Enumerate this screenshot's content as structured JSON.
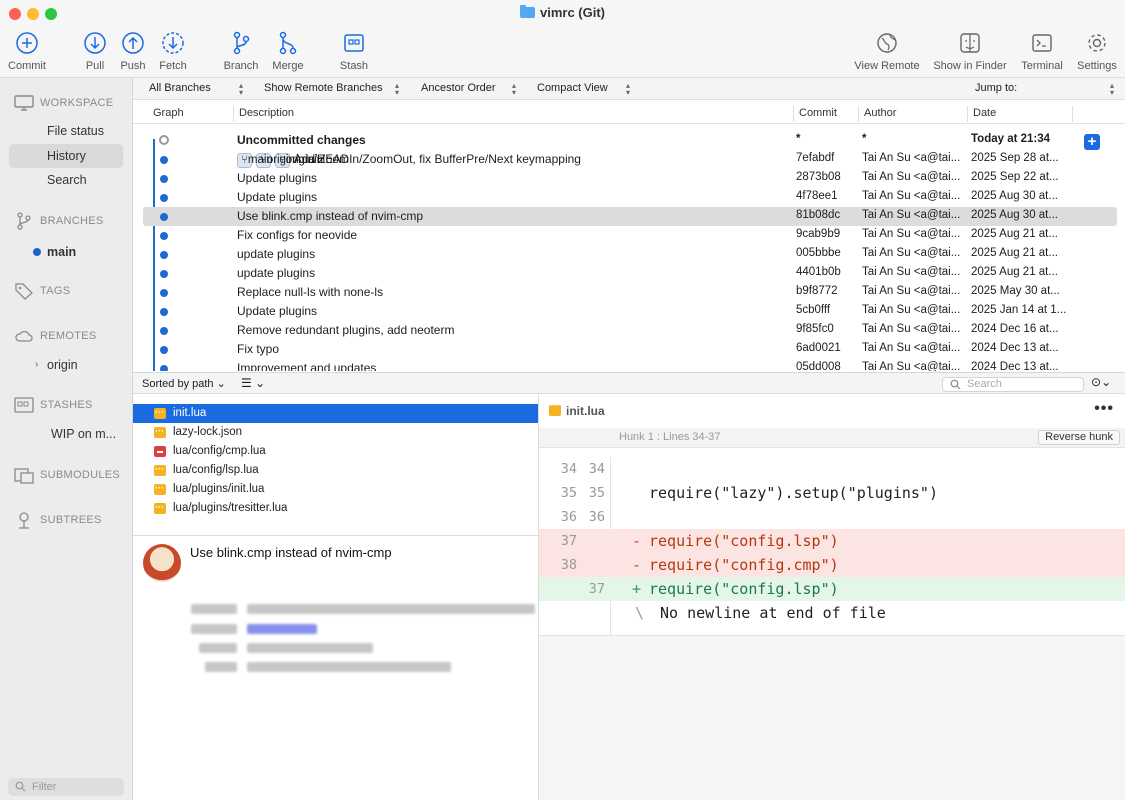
{
  "window": {
    "title": "vimrc (Git)"
  },
  "toolbar": {
    "commit": "Commit",
    "pull": "Pull",
    "push": "Push",
    "fetch": "Fetch",
    "branch": "Branch",
    "merge": "Merge",
    "stash": "Stash",
    "view_remote": "View Remote",
    "show_in_finder": "Show in Finder",
    "terminal": "Terminal",
    "settings": "Settings"
  },
  "sidebar": {
    "workspace": "WORKSPACE",
    "file_status": "File status",
    "history": "History",
    "search": "Search",
    "branches": "BRANCHES",
    "main_branch": "main",
    "tags": "TAGS",
    "remotes": "REMOTES",
    "origin": "origin",
    "stashes": "STASHES",
    "stash_item": "WIP on m...",
    "submodules": "SUBMODULES",
    "subtrees": "SUBTREES",
    "filter_placeholder": "Filter"
  },
  "filterbar": {
    "branches": "All Branches",
    "remote": "Show Remote Branches",
    "order": "Ancestor Order",
    "view": "Compact View",
    "jump": "Jump to:"
  },
  "columns": {
    "graph": "Graph",
    "description": "Description",
    "commit": "Commit",
    "author": "Author",
    "date": "Date"
  },
  "commits": [
    {
      "desc": "Uncommitted changes",
      "hash": "*",
      "author": "*",
      "date": "Today at 21:34"
    },
    {
      "tags": [
        "main",
        "origin/main",
        "origin/HEAD"
      ],
      "desc": "Add ZoomIn/ZoomOut, fix BufferPre/Next keymapping",
      "hash": "7efabdf",
      "author": "Tai An Su <a@tai...",
      "date": "2025 Sep 28 at..."
    },
    {
      "desc": "Update plugins",
      "hash": "2873b08",
      "author": "Tai An Su <a@tai...",
      "date": "2025 Sep 22 at..."
    },
    {
      "desc": "Update plugins",
      "hash": "4f78ee1",
      "author": "Tai An Su <a@tai...",
      "date": "2025 Aug 30 at..."
    },
    {
      "desc": "Use blink.cmp instead of nvim-cmp",
      "hash": "81b08dc",
      "author": "Tai An Su <a@tai...",
      "date": "2025 Aug 30 at..."
    },
    {
      "desc": "Fix configs for neovide",
      "hash": "9cab9b9",
      "author": "Tai An Su <a@tai...",
      "date": "2025 Aug 21 at..."
    },
    {
      "desc": "update plugins",
      "hash": "005bbbe",
      "author": "Tai An Su <a@tai...",
      "date": "2025 Aug 21 at..."
    },
    {
      "desc": "update plugins",
      "hash": "4401b0b",
      "author": "Tai An Su <a@tai...",
      "date": "2025 Aug 21 at..."
    },
    {
      "desc": "Replace null-ls with none-ls",
      "hash": "b9f8772",
      "author": "Tai An Su <a@tai...",
      "date": "2025 May 30 at..."
    },
    {
      "desc": "Update plugins",
      "hash": "5cb0fff",
      "author": "Tai An Su <a@tai...",
      "date": "2025 Jan 14 at 1..."
    },
    {
      "desc": "Remove redundant plugins, add neoterm",
      "hash": "9f85fc0",
      "author": "Tai An Su <a@tai...",
      "date": "2024 Dec 16 at..."
    },
    {
      "desc": "Fix typo",
      "hash": "6ad0021",
      "author": "Tai An Su <a@tai...",
      "date": "2024 Dec 13 at..."
    },
    {
      "desc": "Improvement and updates",
      "hash": "05dd008",
      "author": "Tai An Su <a@tai...",
      "date": "2024 Dec 13 at..."
    }
  ],
  "lowerbar": {
    "sort": "Sorted by path",
    "search_placeholder": "Search"
  },
  "files": [
    {
      "name": "init.lua",
      "status": "modified"
    },
    {
      "name": "lazy-lock.json",
      "status": "modified"
    },
    {
      "name": "lua/config/cmp.lua",
      "status": "deleted"
    },
    {
      "name": "lua/config/lsp.lua",
      "status": "modified"
    },
    {
      "name": "lua/plugins/init.lua",
      "status": "modified"
    },
    {
      "name": "lua/plugins/tresitter.lua",
      "status": "modified"
    }
  ],
  "detail": {
    "title": "Use blink.cmp instead of nvim-cmp"
  },
  "diff": {
    "file": "init.lua",
    "hunk": "Hunk 1 : Lines 34-37",
    "reverse": "Reverse hunk",
    "lines": [
      {
        "old": "34",
        "new": "34",
        "sign": "",
        "text": ""
      },
      {
        "old": "35",
        "new": "35",
        "sign": "",
        "text": "require(\"lazy\").setup(\"plugins\")"
      },
      {
        "old": "36",
        "new": "36",
        "sign": "",
        "text": ""
      },
      {
        "old": "37",
        "new": "",
        "sign": "-",
        "text": "require(\"config.lsp\")"
      },
      {
        "old": "38",
        "new": "",
        "sign": "-",
        "text": "require(\"config.cmp\")"
      },
      {
        "old": "",
        "new": "37",
        "sign": "+",
        "text": "require(\"config.lsp\")"
      },
      {
        "old": "",
        "new": "",
        "sign": "\\",
        "text": " No newline at end of file"
      }
    ]
  },
  "colors": {
    "accent": "#1a6be0",
    "graph": "#1e6ad0",
    "deleted_bg": "#fbe4e1",
    "added_bg": "#e3f6e8"
  }
}
